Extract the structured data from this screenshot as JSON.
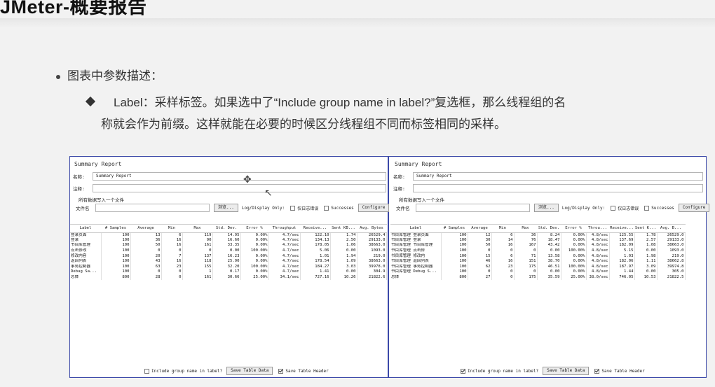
{
  "slide": {
    "title": "JMeter-概要报告",
    "bullet1": "图表中参数描述：",
    "bullet2_line1": "Label：采样标签。如果选中了“Include group name in label?”复选框，那么线程组的名",
    "bullet2_line2": "称就会作为前缀。这样就能在必要的时候区分线程组不同而标签相同的采样。"
  },
  "left": {
    "title": "Summary Report",
    "name_label": "名称:",
    "name_value": "Summary Report",
    "comment_label": "注释:",
    "write_all_label": "所有数据写入一个文件",
    "filename_label": "文件名",
    "browse_label": "浏览...",
    "log_display_label": "Log/Display Only:",
    "errors_only_label": "仅日志错误",
    "successes_label": "Successes",
    "configure_label": "Configure",
    "headers": [
      "Label",
      "# Samples",
      "Average",
      "Min",
      "Max",
      "Std. Dev.",
      "Error %",
      "Throughput",
      "Receive...",
      "Sent KB...",
      "Avg. Bytes"
    ],
    "rows": [
      [
        "登录页面",
        "100",
        "13",
        "6",
        "119",
        "14.95",
        "0.00%",
        "4.7/sec",
        "122.10",
        "1.74",
        "26529.4"
      ],
      [
        "登录",
        "100",
        "36",
        "16",
        "90",
        "16.60",
        "0.00%",
        "4.7/sec",
        "134.13",
        "2.50",
        "29133.0"
      ],
      [
        "书目库管理",
        "100",
        "50",
        "16",
        "161",
        "33.35",
        "0.00%",
        "4.7/sec",
        "178.05",
        "1.06",
        "38663.0"
      ],
      [
        "点击修改",
        "100",
        "0",
        "0",
        "0",
        "0.00",
        "100.00%",
        "4.7/sec",
        "5.06",
        "0.00",
        "1093.0"
      ],
      [
        "修改内容",
        "100",
        "20",
        "7",
        "137",
        "16.23",
        "0.00%",
        "4.7/sec",
        "1.01",
        "1.94",
        "219.0"
      ],
      [
        "返回列表",
        "100",
        "43",
        "16",
        "118",
        "25.90",
        "0.00%",
        "4.7/sec",
        "178.54",
        "1.09",
        "38663.0"
      ],
      [
        "事务控制器",
        "100",
        "63",
        "23",
        "155",
        "32.20",
        "100.00%",
        "4.7/sec",
        "184.27",
        "3.03",
        "39978.0"
      ],
      [
        "Debug Sa...",
        "100",
        "0",
        "0",
        "1",
        "0.17",
        "0.00%",
        "4.7/sec",
        "1.41",
        "0.00",
        "304.9"
      ],
      [
        "总体",
        "800",
        "28",
        "0",
        "161",
        "30.66",
        "25.00%",
        "34.1/sec",
        "727.16",
        "10.26",
        "21822.6"
      ]
    ],
    "include_group_label": "Include group name in label?",
    "include_group_checked": false,
    "save_table_label": "Save Table Data",
    "save_header_label": "Save Table Header",
    "save_header_checked": true
  },
  "right": {
    "title": "Summary Report",
    "name_label": "名称:",
    "name_value": "Summary Report",
    "comment_label": "注释:",
    "write_all_label": "所有数据写入一个文件",
    "filename_label": "文件名",
    "browse_label": "浏览...",
    "log_display_label": "Log/Display Only:",
    "errors_only_label": "仅日志错误",
    "successes_label": "Successes",
    "configure_label": "Configure",
    "headers": [
      "Label",
      "# Samples",
      "Average",
      "Min",
      "Max",
      "Std. Dev.",
      "Error %",
      "Throu...",
      "Receive...",
      "Sent K...",
      "Avg. B..."
    ],
    "rows": [
      [
        "书目库管理 登录页面",
        "100",
        "12",
        "6",
        "36",
        "8.24",
        "0.00%",
        "4.8/sec",
        "125.55",
        "1.78",
        "26529.0"
      ],
      [
        "书目库管理 登录",
        "100",
        "30",
        "14",
        "76",
        "18.47",
        "0.00%",
        "4.8/sec",
        "137.69",
        "2.57",
        "29133.0"
      ],
      [
        "书目库管理 书目库管理",
        "100",
        "50",
        "16",
        "167",
        "43.42",
        "0.00%",
        "4.8/sec",
        "182.09",
        "1.08",
        "38663.0"
      ],
      [
        "书目库管理 点击修",
        "100",
        "0",
        "0",
        "0",
        "0.00",
        "100.00%",
        "4.8/sec",
        "5.15",
        "0.00",
        "1093.0"
      ],
      [
        "书目库管理 修改内",
        "100",
        "15",
        "6",
        "71",
        "13.58",
        "0.00%",
        "4.8/sec",
        "1.03",
        "1.98",
        "219.0"
      ],
      [
        "书目库管理 返回列表",
        "100",
        "46",
        "16",
        "151",
        "38.70",
        "0.00%",
        "4.8/sec",
        "182.06",
        "1.11",
        "38662.8"
      ],
      [
        "书目库管理 事务控制器",
        "100",
        "62",
        "23",
        "175",
        "46.51",
        "100.00%",
        "4.8/sec",
        "187.97",
        "3.09",
        "39974.8"
      ],
      [
        "书目库管理 Debug S...",
        "100",
        "0",
        "0",
        "0",
        "0.00",
        "0.00%",
        "4.8/sec",
        "1.44",
        "0.00",
        "305.0"
      ],
      [
        "总体",
        "800",
        "27",
        "0",
        "175",
        "35.59",
        "25.00%",
        "38.0/sec",
        "746.05",
        "10.53",
        "21822.5"
      ]
    ],
    "include_group_label": "Include group name in label?",
    "include_group_checked": true,
    "save_table_label": "Save Table Data",
    "save_header_label": "Save Table Header",
    "save_header_checked": true
  }
}
